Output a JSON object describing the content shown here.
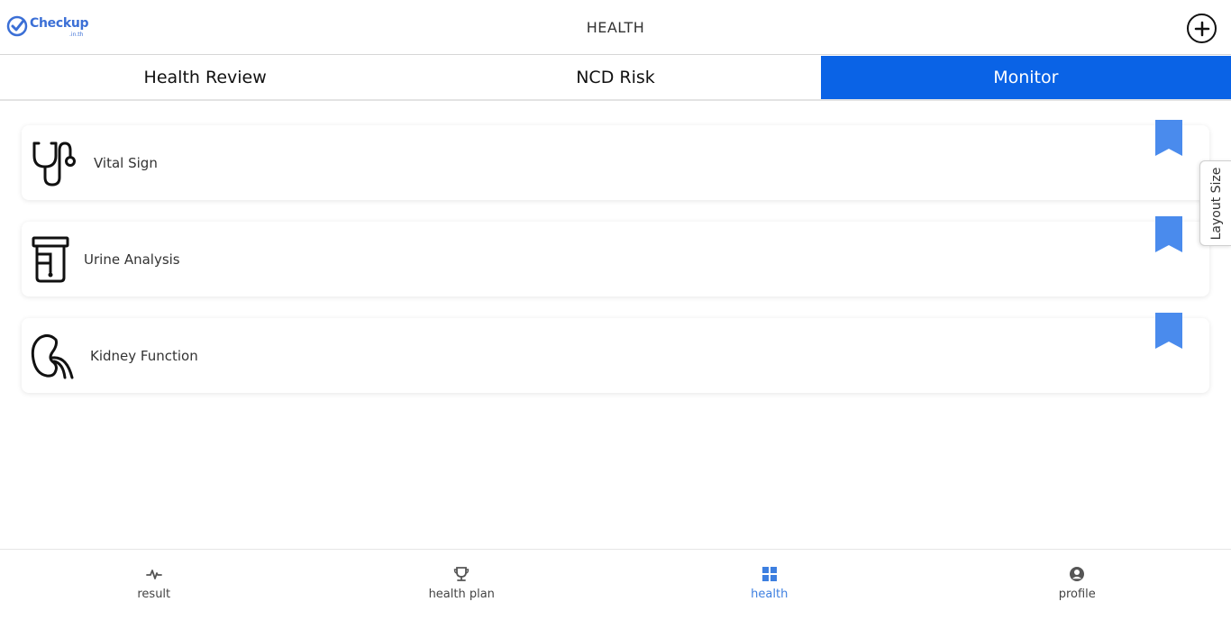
{
  "header": {
    "logo_text": "Checkup",
    "logo_sub": ".in.th",
    "title": "HEALTH",
    "add_icon": "plus-circle-icon"
  },
  "tabs": [
    {
      "label": "Health Review",
      "active": false
    },
    {
      "label": "NCD Risk",
      "active": false
    },
    {
      "label": "Monitor",
      "active": true
    }
  ],
  "cards": [
    {
      "label": "Vital Sign",
      "icon": "stethoscope-icon"
    },
    {
      "label": "Urine Analysis",
      "icon": "urine-sample-icon"
    },
    {
      "label": "Kidney Function",
      "icon": "kidney-icon"
    }
  ],
  "side_tab": {
    "label": "Layout Size"
  },
  "bottom_nav": [
    {
      "label": "result",
      "icon": "pulse-icon",
      "active": false
    },
    {
      "label": "health plan",
      "icon": "trophy-icon",
      "active": false
    },
    {
      "label": "health",
      "icon": "grid-icon",
      "active": true
    },
    {
      "label": "profile",
      "icon": "user-circle-icon",
      "active": false
    }
  ],
  "colors": {
    "accent": "#0a63e6",
    "bookmark": "#4a8bed",
    "nav_active": "#3d7fe0",
    "logo": "#3b6fd6"
  }
}
